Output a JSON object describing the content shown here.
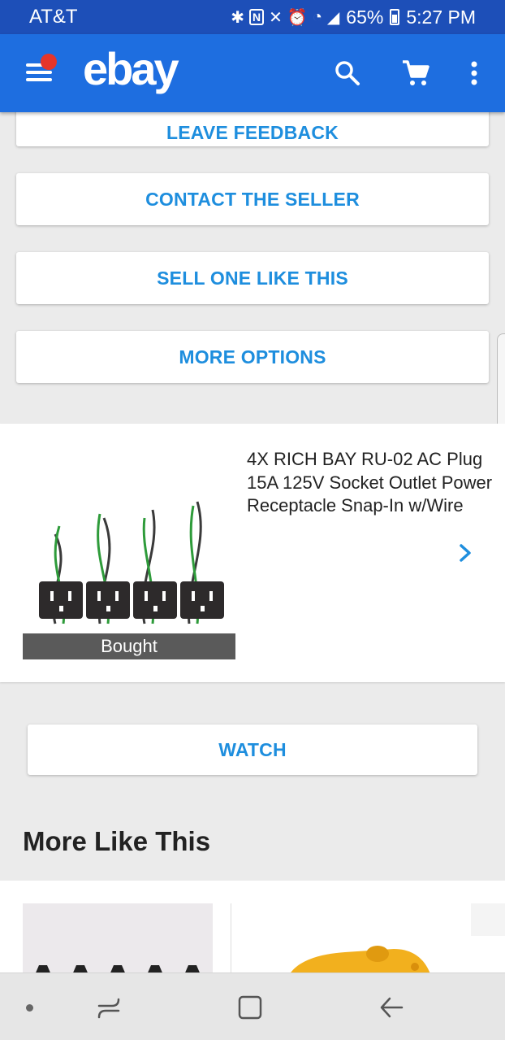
{
  "status_bar": {
    "carrier": "AT&T",
    "battery": "65%",
    "time": "5:27 PM"
  },
  "app_bar": {
    "logo": "ebay"
  },
  "actions": {
    "leave_feedback": "LEAVE FEEDBACK",
    "contact_seller": "CONTACT THE SELLER",
    "sell_one": "SELL ONE LIKE THIS",
    "more_options": "MORE OPTIONS"
  },
  "product": {
    "title": "4X RICH BAY RU-02 AC Plug 15A 125V Socket Outlet Power Receptacle Snap-In w/Wire",
    "badge": "Bought"
  },
  "watch_button": "WATCH",
  "more_like_this": {
    "title": "More Like This"
  },
  "colors": {
    "status_bar": "#1d4fb8",
    "app_bar": "#1e6ee0",
    "link_blue": "#1e8ede",
    "notification_dot": "#e5352a"
  }
}
